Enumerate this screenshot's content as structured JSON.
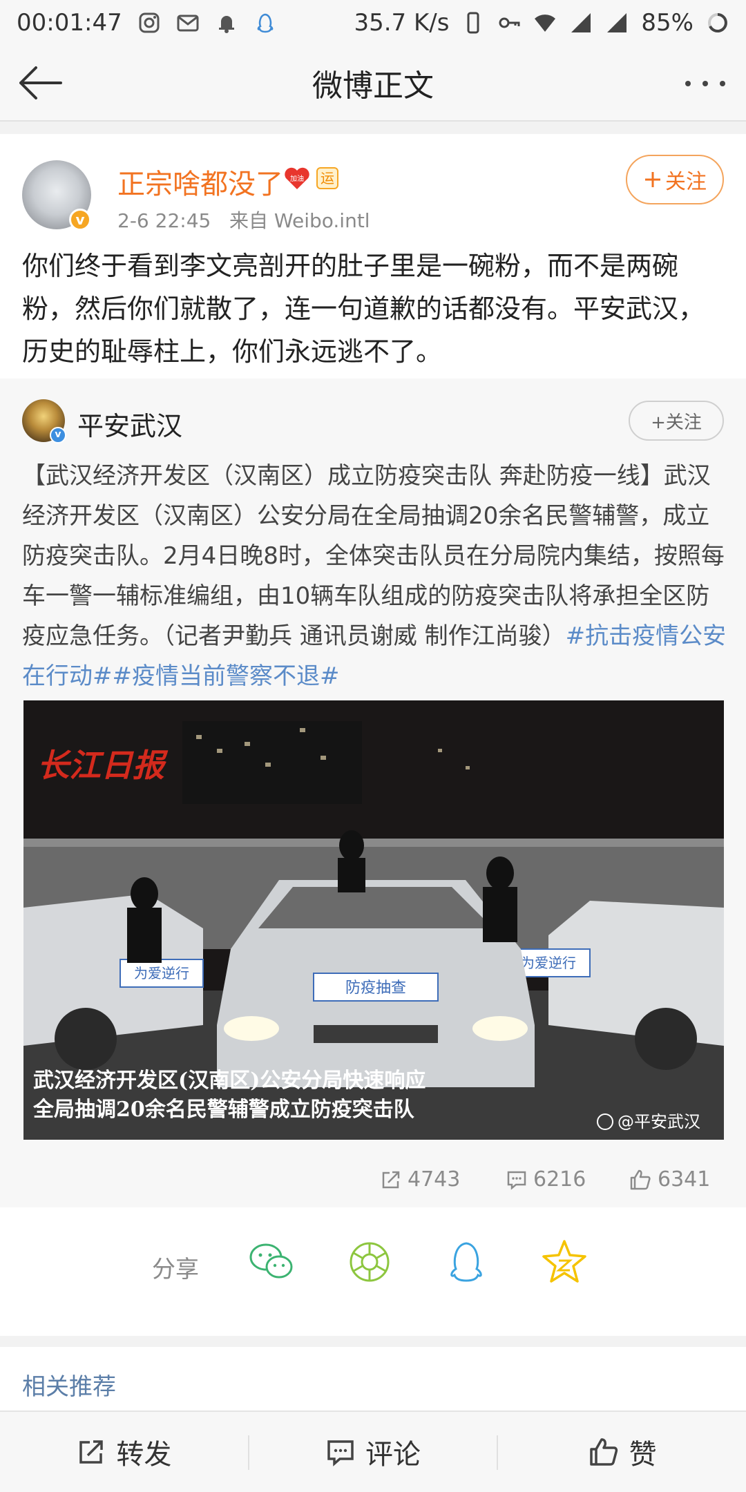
{
  "status": {
    "time": "00:01:47",
    "speed": "35.7 K/s",
    "battery": "85%"
  },
  "nav": {
    "title": "微博正文"
  },
  "post": {
    "username": "正宗啥都没了",
    "heart_badge": "加油",
    "yun_badge": "运",
    "verified": "v",
    "time": "2-6 22:45",
    "source": "来自 Weibo.intl",
    "follow_label": "关注",
    "text": "你们终于看到李文亮剖开的肚子里是一碗粉，而不是两碗粉，然后你们就散了，连一句道歉的话都没有。平安武汉，历史的耻辱柱上，你们永远逃不了。"
  },
  "repost": {
    "username": "平安武汉",
    "follow_label": "+关注",
    "text": "【武汉经济开发区（汉南区）成立防疫突击队 奔赴防疫一线】武汉经济开发区（汉南区）公安分局在全局抽调20余名民警辅警，成立防疫突击队。2月4日晚8时，全体突击队员在分局院内集结，按照每车一警一辅标准编组，由10辆车队组成的防疫突击队将承担全区防疫应急任务。（记者尹勤兵 通讯员谢威 制作江尚骏）",
    "hashtags": "#抗击疫情公安在行动##疫情当前警察不退#",
    "media": {
      "logo": "长江日报",
      "caption_line1": "武汉经济开发区(汉南区)公安分局快速响应",
      "caption_line2": "全局抽调20余名民警辅警成立防疫突击队",
      "watermark": "@平安武汉",
      "car_label_left": "为爱逆行",
      "car_label_center": "防疫抽查",
      "car_label_right": "为爱逆行"
    },
    "stats": {
      "reposts": "4743",
      "comments": "6216",
      "likes": "6341"
    }
  },
  "share": {
    "label": "分享"
  },
  "related": {
    "label": "相关推荐"
  },
  "tabs": {
    "repost": "转发",
    "comment": "评论",
    "like": "赞"
  },
  "colors": {
    "accent_orange": "#f27321",
    "link_blue": "#5b8bc8",
    "related_blue": "#5b7ea8"
  }
}
